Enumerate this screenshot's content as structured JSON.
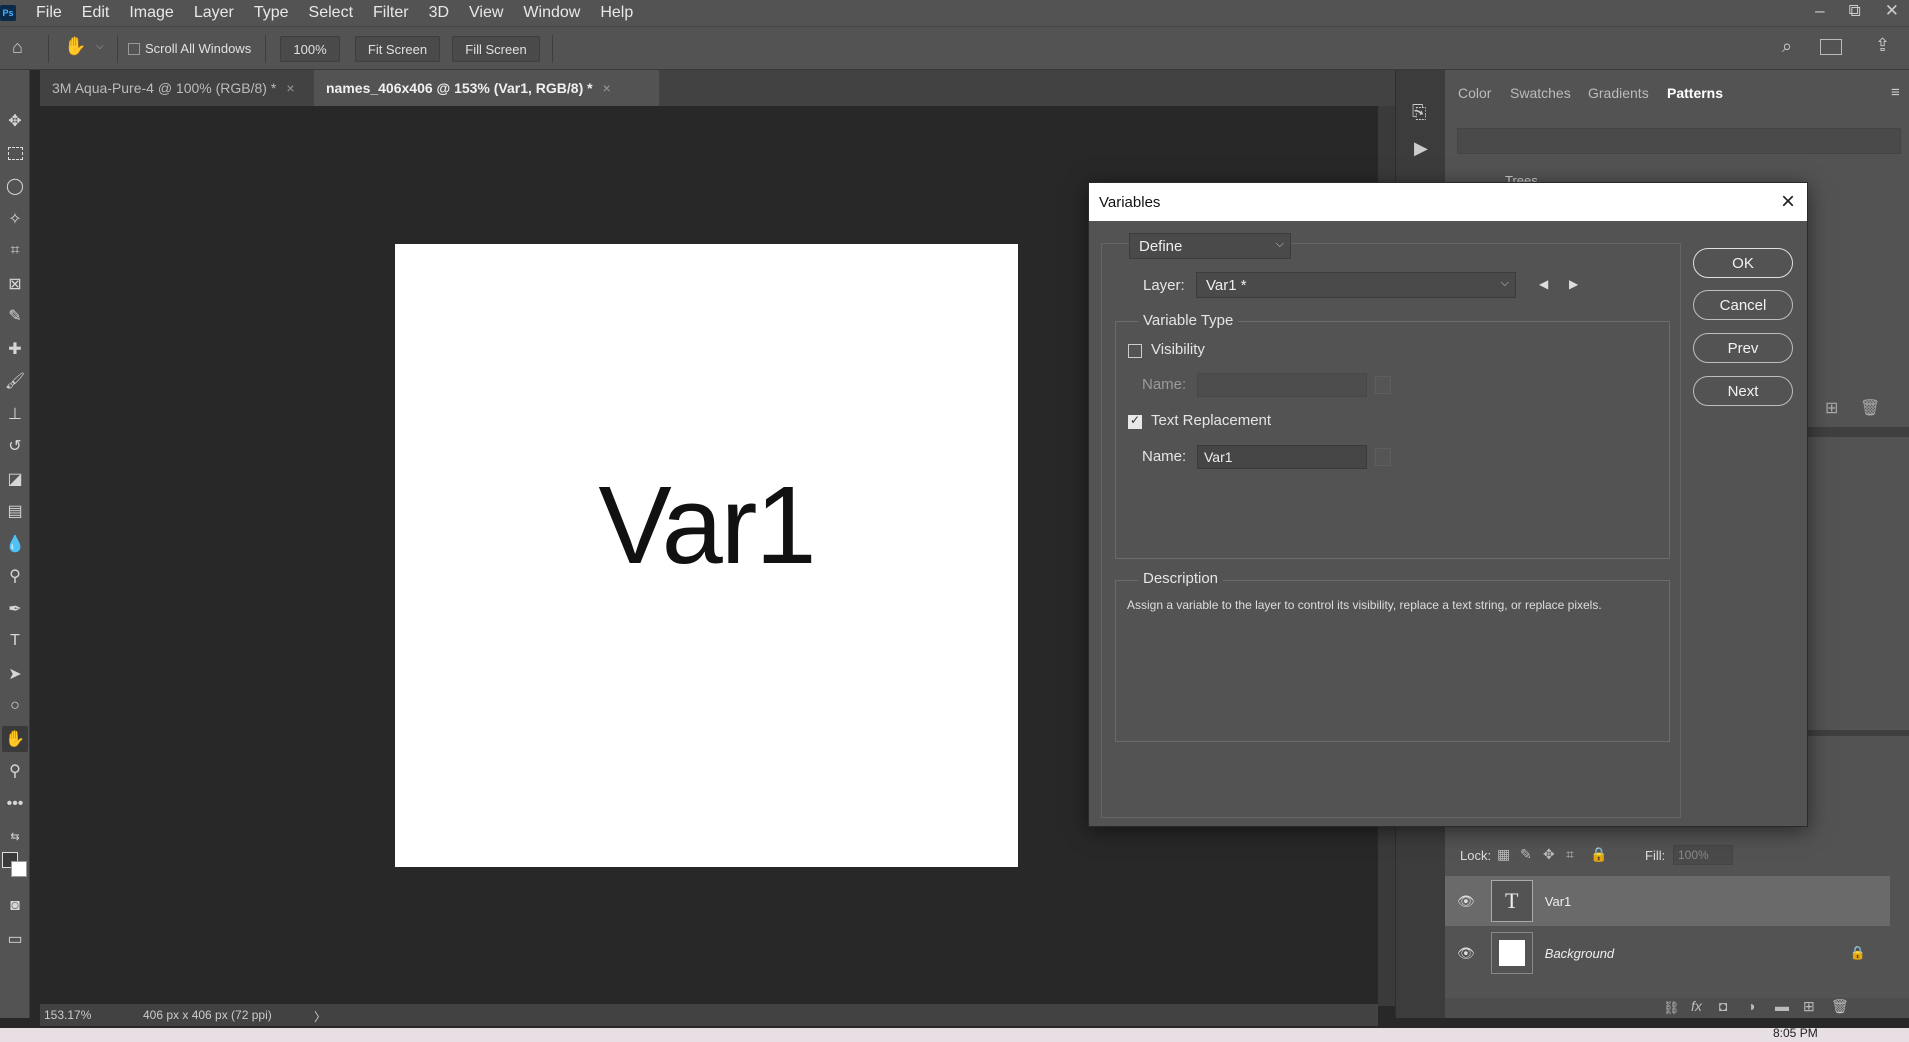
{
  "app": {
    "logo": "Ps"
  },
  "menu": [
    "File",
    "Edit",
    "Image",
    "Layer",
    "Type",
    "Select",
    "Filter",
    "3D",
    "View",
    "Window",
    "Help"
  ],
  "window_controls": {
    "minimize": "–",
    "restore": "⧉",
    "close": "✕"
  },
  "options": {
    "scroll_all_windows": "Scroll All Windows",
    "zoom": "100%",
    "fit_screen": "Fit Screen",
    "fill_screen": "Fill Screen"
  },
  "tabs": [
    {
      "label": "3M Aqua-Pure-4 @ 100% (RGB/8) *",
      "close": "×"
    },
    {
      "label": "names_406x406 @ 153% (Var1, RGB/8) *",
      "close": "×"
    }
  ],
  "canvas": {
    "text": "Var1"
  },
  "status": {
    "zoom": "153.17%",
    "doc_info": "406 px x 406 px (72 ppi)",
    "arrow": "〉"
  },
  "panels": {
    "tabs": [
      "Color",
      "Swatches",
      "Gradients",
      "Patterns"
    ],
    "active_tab": "Patterns",
    "pattern_folder": "Trees"
  },
  "layers": {
    "lock_label": "Lock:",
    "fill_label": "Fill:",
    "fill_value": "100%",
    "items": [
      {
        "name": "Var1",
        "type": "text",
        "thumb": "T"
      },
      {
        "name": "Background",
        "type": "image"
      }
    ]
  },
  "dialog": {
    "title": "Variables",
    "mode": "Define",
    "layer_label": "Layer:",
    "layer_value": "Var1 *",
    "variable_type_label": "Variable Type",
    "visibility_label": "Visibility",
    "visibility_checked": false,
    "name_label": "Name:",
    "visibility_name": "",
    "text_replacement_label": "Text Replacement",
    "text_replacement_checked": true,
    "text_name": "Var1",
    "description_label": "Description",
    "description_text": "Assign a variable to the layer to control its visibility, replace a text string, or replace pixels.",
    "ok": "OK",
    "cancel": "Cancel",
    "prev": "Prev",
    "next": "Next"
  },
  "taskbar": {
    "time": "8:05 PM"
  }
}
